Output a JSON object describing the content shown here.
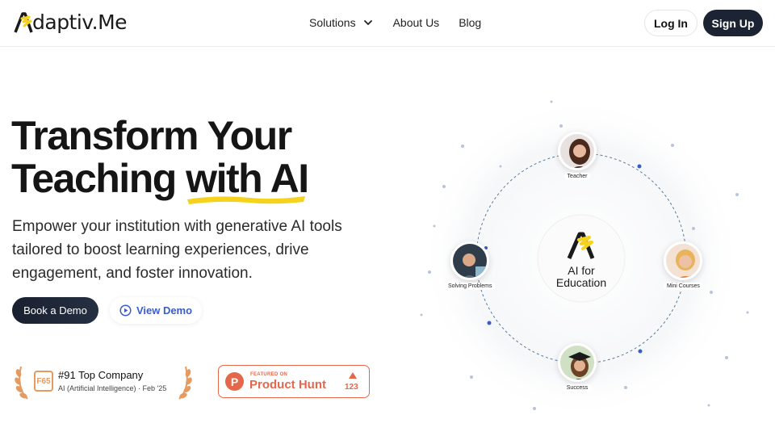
{
  "brand": {
    "name": "daptiv.Me",
    "accent": "#f5d31c",
    "dark": "#1c2433",
    "link_blue": "#3a5cc9",
    "ph_orange": "#e4674b"
  },
  "nav": {
    "solutions": "Solutions",
    "about": "About Us",
    "blog": "Blog",
    "login": "Log In",
    "signup": "Sign Up"
  },
  "hero": {
    "title_line1": "Transform Your",
    "title_line2_a": "Teaching ",
    "title_line2_b": "with AI",
    "subtitle": "Empower your institution with generative AI tools tailored to boost learning experiences, drive engagement, and foster innovation.",
    "book_demo": "Book a Demo",
    "view_demo": "View Demo"
  },
  "badges": {
    "award_logo": "F65",
    "award_title": "#91 Top Company",
    "award_sub": "AI (Artificial Intelligence) · Feb '25",
    "ph_featured": "FEATURED ON",
    "ph_name": "Product Hunt",
    "ph_count": "123"
  },
  "diagram": {
    "center_label_1": "AI for",
    "center_label_2": "Education",
    "nodes": {
      "teacher": "Teacher",
      "solving": "Solving Problems",
      "mini": "Mini Courses",
      "success": "Success"
    }
  }
}
